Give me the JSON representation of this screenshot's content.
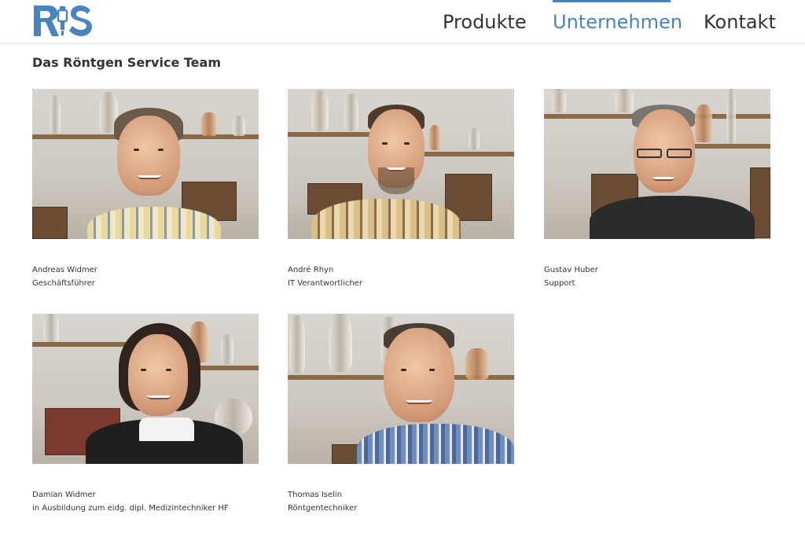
{
  "header": {
    "logo_text": "RiS",
    "nav": [
      {
        "label": "Produkte",
        "active": false
      },
      {
        "label": "Unternehmen",
        "active": true
      },
      {
        "label": "Kontakt",
        "active": false
      }
    ]
  },
  "colors": {
    "accent": "#4a84bf",
    "logo": "#4a84bf",
    "text": "#333333"
  },
  "page_title": "Das Röntgen Service Team",
  "team": [
    {
      "name": "Andreas Widmer",
      "role": "Geschäftsführer"
    },
    {
      "name": "André Rhyn",
      "role": "IT Verantwortlicher"
    },
    {
      "name": "Gustav Huber",
      "role": "Support"
    },
    {
      "name": "Damian Widmer",
      "role": "in Ausbildung zum eidg. dipl. Medizintechniker HF"
    },
    {
      "name": "Thomas Iselin",
      "role": "Röntgentechniker"
    }
  ]
}
